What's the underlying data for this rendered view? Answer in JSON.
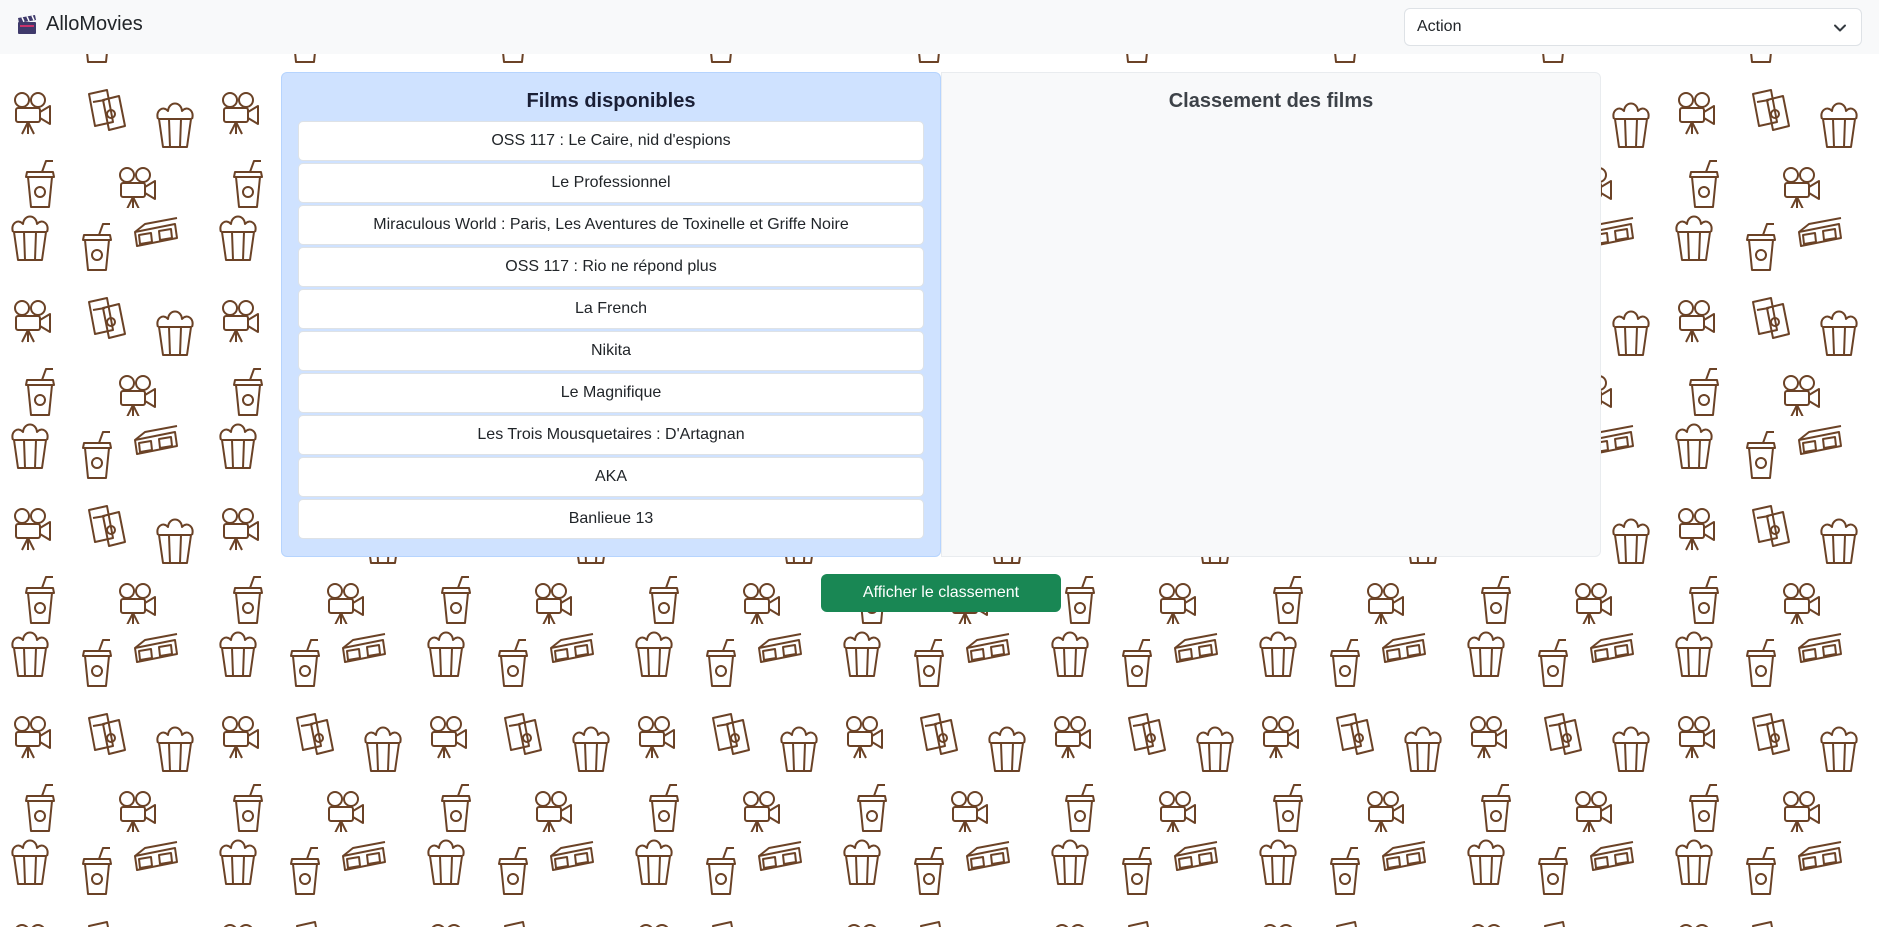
{
  "navbar": {
    "brand": "AlloMovies",
    "brand_icon": "clapperboard-icon",
    "genre_select": {
      "selected": "Action",
      "icon": "chevron-down-icon"
    }
  },
  "available_panel": {
    "title": "Films disponibles",
    "films": [
      "OSS 117 : Le Caire, nid d'espions",
      "Le Professionnel",
      "Miraculous World : Paris, Les Aventures de Toxinelle et Griffe Noire",
      "OSS 117 : Rio ne répond plus",
      "La French",
      "Nikita",
      "Le Magnifique",
      "Les Trois Mousquetaires : D'Artagnan",
      "AKA",
      "Banlieue 13"
    ]
  },
  "ranking_panel": {
    "title": "Classement des films"
  },
  "actions": {
    "show_ranking": "Afficher le classement"
  },
  "background": {
    "icons": [
      "popcorn-icon",
      "drink-cup-icon",
      "3d-glasses-icon",
      "movie-camera-icon",
      "tickets-icon"
    ],
    "line_color": "#6b4226"
  },
  "colors": {
    "available_bg": "#cfe2ff",
    "button_green": "#198754",
    "navbar_bg": "#f8f9fa"
  }
}
